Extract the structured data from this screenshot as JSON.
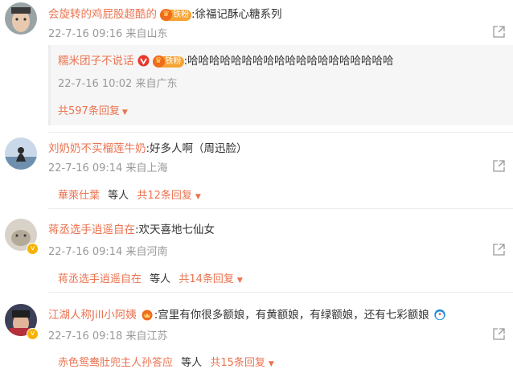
{
  "comments": [
    {
      "user": "会旋转的鸡屁股超酷的",
      "fan_badge": "铁粉",
      "text": ":徐福记酥心糖系列",
      "meta": "22-7-16 09:16 来自山东",
      "sub_reply": {
        "user": "糯米团子不说话",
        "fan_badge": "铁粉",
        "text": ":哈哈哈哈哈哈哈哈哈哈哈哈哈哈哈哈哈哈哈",
        "meta": "22-7-16 10:02 来自广东"
      },
      "reply_count": "共597条回复"
    },
    {
      "user": "刘奶奶不买榴莲牛奶",
      "text": ":好多人啊（周迅脸）",
      "meta": "22-7-16 09:14 来自上海",
      "repliers": "華萊仕葉",
      "others": "等人",
      "reply_count": "共12条回复"
    },
    {
      "user": "蒋丞选手逍遥自在",
      "text": ":欢天喜地七仙女",
      "meta": "22-7-16 09:14 来自河南",
      "repliers": "蒋丞选手逍遥自在",
      "others": "等人",
      "reply_count": "共14条回复"
    },
    {
      "user": "江湖人称Jill小阿姨",
      "text": ":宫里有你很多额娘，有黄额娘，有绿额娘，还有七彩额娘",
      "meta": "22-7-16 09:18 来自江苏",
      "repliers": "赤色鸳鸯肚兜主人孙答应",
      "others": "等人",
      "reply_count": "共15条回复"
    }
  ],
  "colors": {
    "accent": "#eb7350",
    "meta": "#999999",
    "badge": "#f7a334"
  }
}
